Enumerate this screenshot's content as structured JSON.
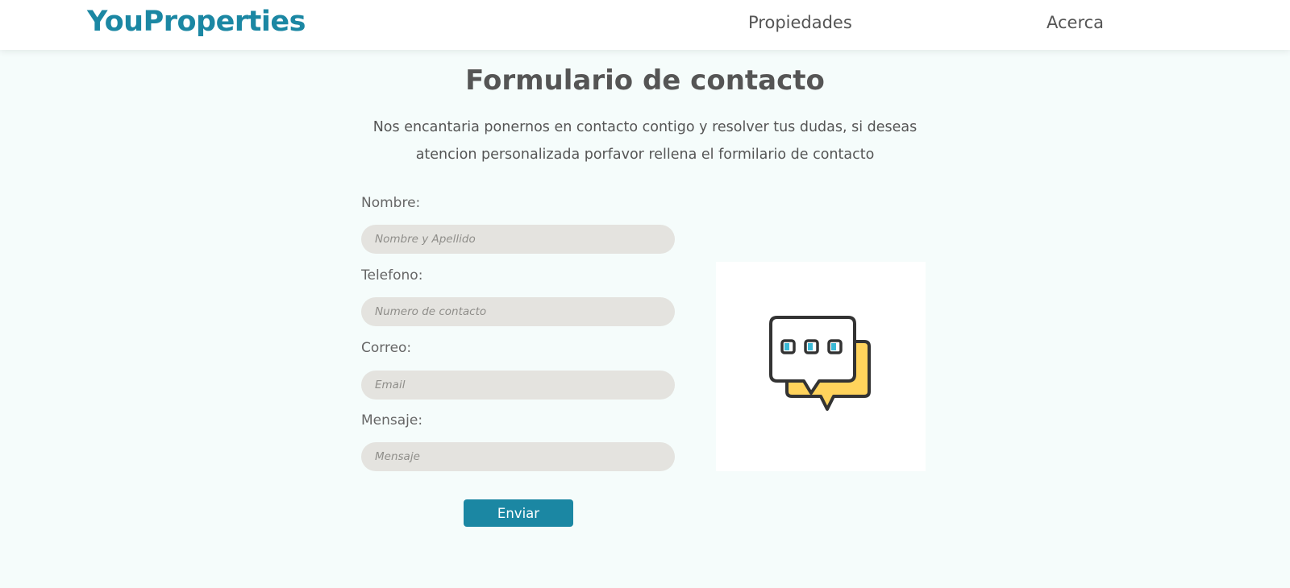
{
  "header": {
    "brand": "YouProperties",
    "nav": [
      {
        "label": "Propiedades"
      },
      {
        "label": "Acerca"
      }
    ]
  },
  "main": {
    "title": "Formulario de contacto",
    "intro_line1": "Nos encantaria ponernos en contacto contigo y resolver tus dudas, si deseas",
    "intro_line2": "atencion personalizada porfavor rellena el formilario de contacto"
  },
  "form": {
    "fields": [
      {
        "label": "Nombre:",
        "placeholder": "Nombre y Apellido",
        "value": ""
      },
      {
        "label": "Telefono:",
        "placeholder": "Numero de contacto",
        "value": ""
      },
      {
        "label": "Correo:",
        "placeholder": "Email",
        "value": ""
      },
      {
        "label": "Mensaje:",
        "placeholder": "Mensaje",
        "value": ""
      }
    ],
    "submit_label": "Enviar"
  },
  "illustration": {
    "icon": "chat-bubbles-icon"
  },
  "colors": {
    "brand": "#1b87a3",
    "page_background": "#f5fcfb",
    "input_background": "#e4e3df",
    "bubble_yellow": "#ffd35c",
    "bubble_outline": "#333333",
    "dot_accent": "#3bb9d6"
  }
}
